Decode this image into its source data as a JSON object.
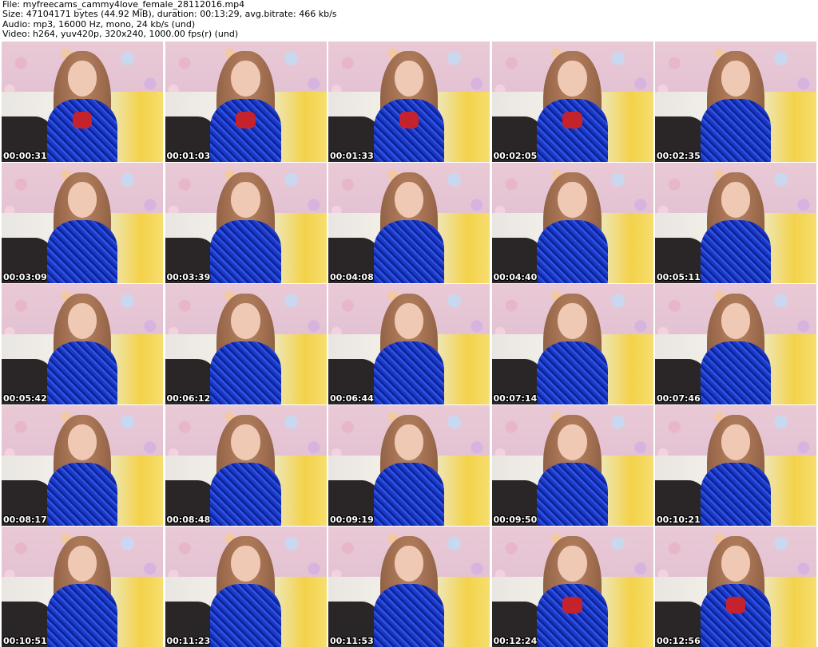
{
  "header": {
    "file_line": "File: myfreecams_cammy4love_female_28112016.mp4",
    "size_line": "Size: 47104171 bytes (44.92 MiB), duration: 00:13:29, avg.bitrate: 466 kb/s",
    "audio_line": "Audio: mp3, 16000 Hz, mono, 24 kb/s (und)",
    "video_line": "Video: h264, yuv420p, 320x240, 1000.00 fps(r) (und)"
  },
  "thumbnails": [
    {
      "timestamp": "00:00:31",
      "variant": "red-top"
    },
    {
      "timestamp": "00:01:03",
      "variant": "red-top"
    },
    {
      "timestamp": "00:01:33",
      "variant": "red-top"
    },
    {
      "timestamp": "00:02:05",
      "variant": "red-top"
    },
    {
      "timestamp": "00:02:35",
      "variant": "boa"
    },
    {
      "timestamp": "00:03:09",
      "variant": "boa"
    },
    {
      "timestamp": "00:03:39",
      "variant": "boa"
    },
    {
      "timestamp": "00:04:08",
      "variant": "boa"
    },
    {
      "timestamp": "00:04:40",
      "variant": "boa"
    },
    {
      "timestamp": "00:05:11",
      "variant": "boa"
    },
    {
      "timestamp": "00:05:42",
      "variant": "boa"
    },
    {
      "timestamp": "00:06:12",
      "variant": "boa"
    },
    {
      "timestamp": "00:06:44",
      "variant": "boa"
    },
    {
      "timestamp": "00:07:14",
      "variant": "boa"
    },
    {
      "timestamp": "00:07:46",
      "variant": "boa"
    },
    {
      "timestamp": "00:08:17",
      "variant": "boa"
    },
    {
      "timestamp": "00:08:48",
      "variant": "boa"
    },
    {
      "timestamp": "00:09:19",
      "variant": "boa"
    },
    {
      "timestamp": "00:09:50",
      "variant": "boa"
    },
    {
      "timestamp": "00:10:21",
      "variant": "boa"
    },
    {
      "timestamp": "00:10:51",
      "variant": "boa"
    },
    {
      "timestamp": "00:11:23",
      "variant": "boa"
    },
    {
      "timestamp": "00:11:53",
      "variant": "boa"
    },
    {
      "timestamp": "00:12:24",
      "variant": "red-top"
    },
    {
      "timestamp": "00:12:56",
      "variant": "red-top"
    }
  ],
  "colors": {
    "background": "#ffffff",
    "boa_blue": "#1c39c9",
    "top_red": "#c4222d",
    "couch_yellow": "#f3d24a"
  }
}
